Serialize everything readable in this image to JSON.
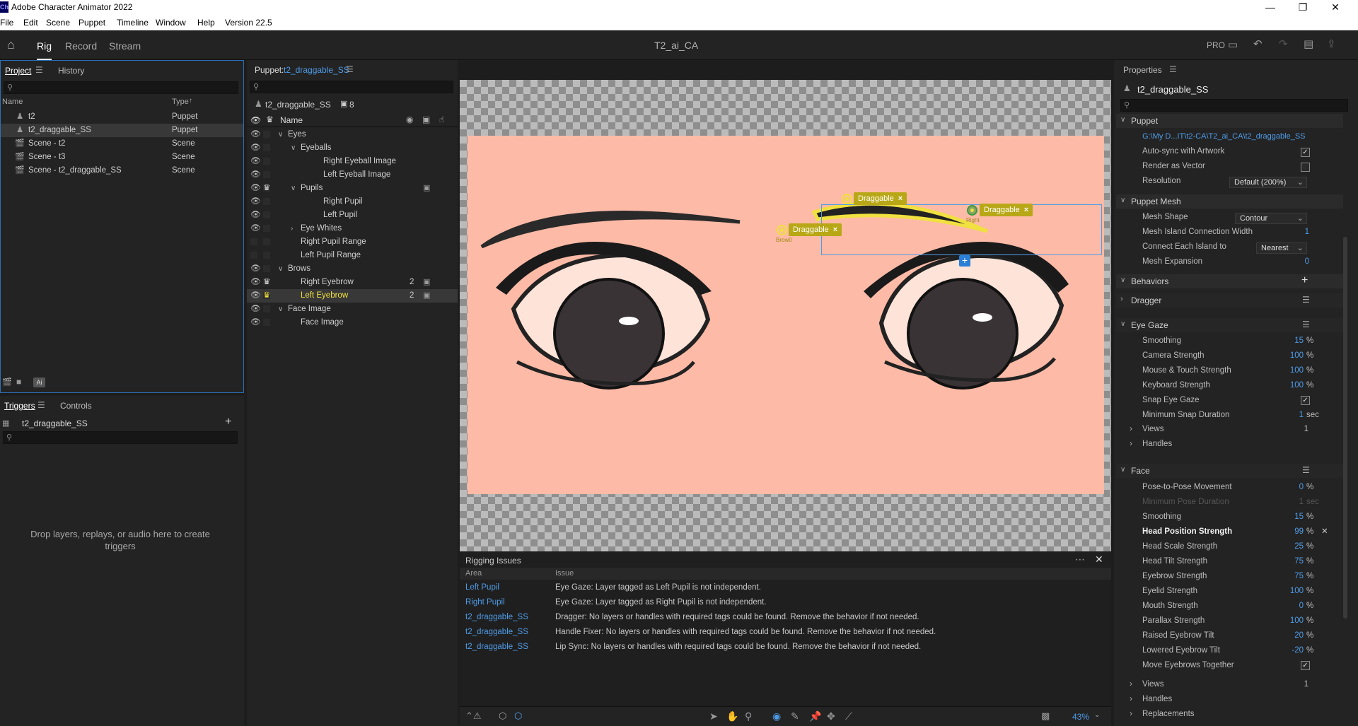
{
  "app": {
    "title": "Adobe Character Animator 2022",
    "logo": "Ch",
    "window_controls": {
      "minimize": "—",
      "maximize": "❐",
      "close": "✕"
    }
  },
  "menu": [
    "File",
    "Edit",
    "Scene",
    "Puppet",
    "Timeline",
    "Window",
    "Help",
    "Version 22.5"
  ],
  "toolbar": {
    "tabs": [
      "Rig",
      "Record",
      "Stream"
    ],
    "active_tab": "Rig",
    "document_title": "T2_ai_CA",
    "pro_label": "PRO"
  },
  "project": {
    "tabs": [
      "Project",
      "History"
    ],
    "col_name": "Name",
    "col_type": "Type",
    "items": [
      {
        "name": "t2",
        "type": "Puppet"
      },
      {
        "name": "t2_draggable_SS",
        "type": "Puppet"
      },
      {
        "name": "Scene - t2",
        "type": "Scene"
      },
      {
        "name": "Scene - t3",
        "type": "Scene"
      },
      {
        "name": "Scene - t2_draggable_SS",
        "type": "Scene"
      }
    ],
    "ai_badge": "Ai"
  },
  "triggers": {
    "tabs": [
      "Triggers",
      "Controls"
    ],
    "puppet": "t2_draggable_SS",
    "empty_message": "Drop layers, replays, or audio here to create triggers"
  },
  "puppet_panel": {
    "label": "Puppet:",
    "puppet_name": "t2_draggable_SS",
    "count": "8",
    "col_name": "Name",
    "layers": [
      {
        "name": "Eyes",
        "indent": 0,
        "arrow": "v",
        "eye": true
      },
      {
        "name": "Eyeballs",
        "indent": 1,
        "arrow": "v",
        "eye": true
      },
      {
        "name": "Right Eyeball Image",
        "indent": 2,
        "eye": true
      },
      {
        "name": "Left Eyeball Image",
        "indent": 2,
        "eye": true
      },
      {
        "name": "Pupils",
        "indent": 1,
        "arrow": "v",
        "eye": true,
        "crown": true,
        "clip": true
      },
      {
        "name": "Right Pupil",
        "indent": 2,
        "eye": true
      },
      {
        "name": "Left Pupil",
        "indent": 2,
        "eye": true
      },
      {
        "name": "Eye Whites",
        "indent": 1,
        "arrow": ">",
        "eye": true
      },
      {
        "name": "Right Pupil Range",
        "indent": 1,
        "eye": false
      },
      {
        "name": "Left Pupil Range",
        "indent": 1,
        "eye": false
      },
      {
        "name": "Brows",
        "indent": 0,
        "arrow": "v",
        "eye": true
      },
      {
        "name": "Right Eyebrow",
        "indent": 1,
        "eye": true,
        "crown": true,
        "num": "2"
      },
      {
        "name": "Left Eyebrow",
        "indent": 1,
        "eye": true,
        "crown": true,
        "num": "2",
        "selected": true
      },
      {
        "name": "Face Image",
        "indent": 0,
        "arrow": "v",
        "eye": true
      },
      {
        "name": "Face Image",
        "indent": 1,
        "eye": true
      }
    ]
  },
  "canvas": {
    "handles": [
      {
        "label": "Draggable"
      },
      {
        "label": "Draggable"
      },
      {
        "label": "Draggable"
      }
    ],
    "handle_tags": [
      "Brow0",
      "Right"
    ],
    "zoom": "43%"
  },
  "rigging": {
    "title": "Rigging Issues",
    "col_area": "Area",
    "col_issue": "Issue",
    "rows": [
      {
        "area": "Left Pupil",
        "issue": "Eye Gaze: Layer tagged as Left Pupil is not independent."
      },
      {
        "area": "Right Pupil",
        "issue": "Eye Gaze: Layer tagged as Right Pupil is not independent."
      },
      {
        "area": "t2_draggable_SS",
        "issue": "Dragger: No layers or handles with required tags could be found. Remove the behavior if not needed."
      },
      {
        "area": "t2_draggable_SS",
        "issue": "Handle Fixer: No layers or handles with required tags could be found. Remove the behavior if not needed."
      },
      {
        "area": "t2_draggable_SS",
        "issue": "Lip Sync: No layers or handles with required tags could be found. Remove the behavior if not needed."
      }
    ]
  },
  "properties": {
    "title": "Properties",
    "puppet_name": "t2_draggable_SS",
    "puppet_section": "Puppet",
    "path": "G:\\My D...IT\\t2-CA\\T2_ai_CA\\t2_draggable_SS",
    "auto_sync": "Auto-sync with Artwork",
    "render_vector": "Render as Vector",
    "resolution_label": "Resolution",
    "resolution_value": "Default (200%)",
    "mesh_section": "Puppet Mesh",
    "mesh_shape_label": "Mesh Shape",
    "mesh_shape_value": "Contour",
    "mesh_island_label": "Mesh Island Connection Width",
    "mesh_island_value": "1",
    "connect_label": "Connect Each Island to",
    "connect_value": "Nearest",
    "mesh_expansion_label": "Mesh Expansion",
    "mesh_expansion_value": "0",
    "behaviors_section": "Behaviors",
    "dragger": "Dragger",
    "eye_gaze": {
      "title": "Eye Gaze",
      "rows": [
        {
          "label": "Smoothing",
          "value": "15",
          "unit": "%"
        },
        {
          "label": "Camera Strength",
          "value": "100",
          "unit": "%"
        },
        {
          "label": "Mouse & Touch Strength",
          "value": "100",
          "unit": "%"
        },
        {
          "label": "Keyboard Strength",
          "value": "100",
          "unit": "%"
        },
        {
          "label": "Snap Eye Gaze",
          "check": true
        },
        {
          "label": "Minimum Snap Duration",
          "value": "1",
          "unit": "sec"
        }
      ],
      "views_label": "Views",
      "views_value": "1",
      "handles_label": "Handles"
    },
    "face": {
      "title": "Face",
      "rows": [
        {
          "label": "Pose-to-Pose Movement",
          "value": "0",
          "unit": "%"
        },
        {
          "label": "Minimum Pose Duration",
          "value": "1",
          "unit": "sec",
          "dim": true
        },
        {
          "label": "Smoothing",
          "value": "15",
          "unit": "%"
        },
        {
          "label": "Head Position Strength",
          "value": "99",
          "unit": "%",
          "bold": true
        },
        {
          "label": "Head Scale Strength",
          "value": "25",
          "unit": "%"
        },
        {
          "label": "Head Tilt Strength",
          "value": "75",
          "unit": "%"
        },
        {
          "label": "Eyebrow Strength",
          "value": "75",
          "unit": "%"
        },
        {
          "label": "Eyelid Strength",
          "value": "100",
          "unit": "%"
        },
        {
          "label": "Mouth Strength",
          "value": "0",
          "unit": "%"
        },
        {
          "label": "Parallax Strength",
          "value": "100",
          "unit": "%"
        },
        {
          "label": "Raised Eyebrow Tilt",
          "value": "20",
          "unit": "%"
        },
        {
          "label": "Lowered Eyebrow Tilt",
          "value": "-20",
          "unit": "%"
        },
        {
          "label": "Move Eyebrows Together",
          "check": true
        }
      ],
      "views_label": "Views",
      "views_value": "1",
      "handles_label": "Handles",
      "replacements_label": "Replacements"
    }
  },
  "colors": {
    "accent": "#4f9ce8",
    "handle": "#b8a817",
    "skin": "#fdbaa6",
    "selection": "#f0e040"
  }
}
